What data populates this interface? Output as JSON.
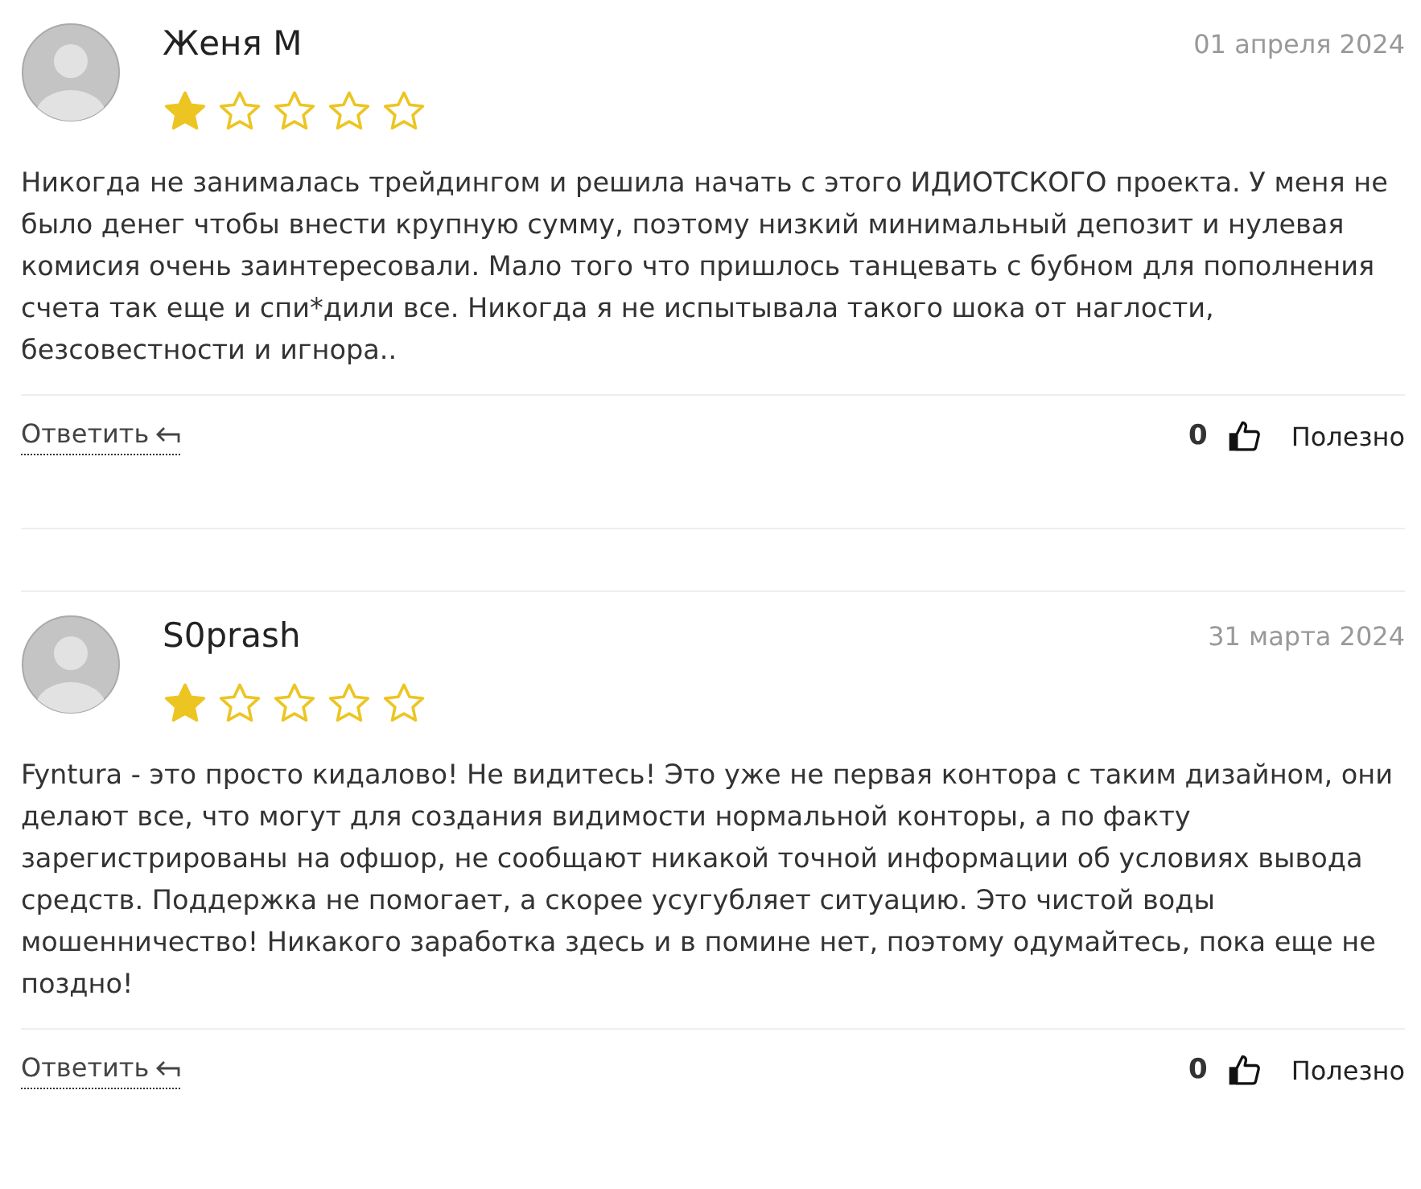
{
  "reviews": [
    {
      "author": "Женя М",
      "date": "01 апреля 2024",
      "stars": 1,
      "text": "Никогда не занималась трейдингом и решила начать с этого ИДИОТСКОГО проекта. У меня не было денег чтобы внести крупную сумму, поэтому низкий минимальный депозит и нулевая комисия очень заинтересовали. Мало того что пришлось танцевать с бубном для пополнения счета так еще и спи*дили все. Никогда я не испытывала такого шока от наглости, безсовестности и игнора..",
      "reply": "Ответить",
      "votes": "0",
      "helpful": "Полезно"
    },
    {
      "author": "S0prash",
      "date": "31 марта 2024",
      "stars": 1,
      "text": "Fyntura - это просто кидалово! Не видитесь! Это уже не первая контора с таким дизайном, они делают все, что могут для создания видимости нормальной конторы, а по факту зарегистрированы на офшор, не сообщают никакой точной информации об условиях вывода средств. Поддержка не помогает, а скорее усугубляет ситуацию. Это чистой воды мошенничество! Никакого заработка здесь и в помине нет, поэтому одумайтесь, пока еще не поздно!",
      "reply": "Ответить",
      "votes": "0",
      "helpful": "Полезно"
    }
  ]
}
